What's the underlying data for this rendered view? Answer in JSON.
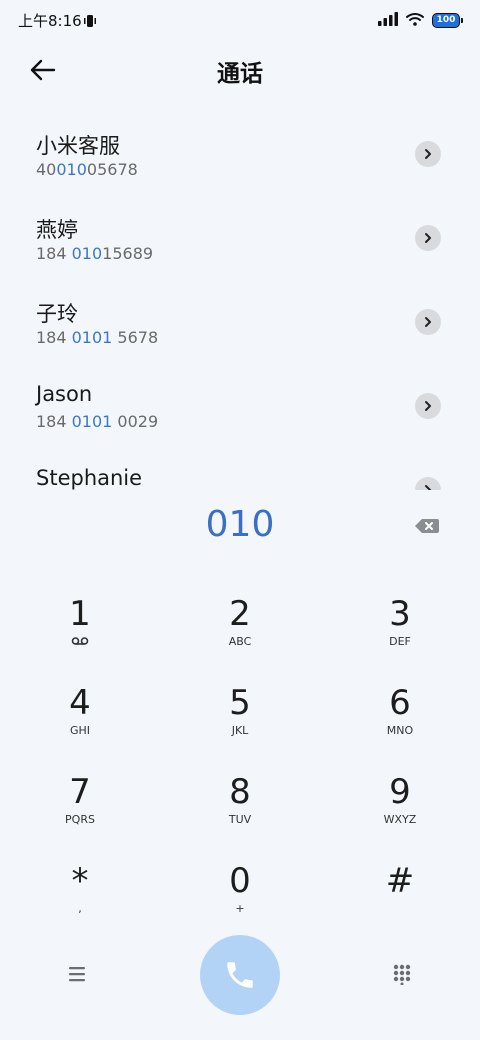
{
  "status_bar": {
    "time": "上午8:16",
    "battery": "100"
  },
  "header": {
    "title": "通话"
  },
  "results": [
    {
      "name": "小米客服",
      "number_pre": "40",
      "number_match": "010",
      "number_post": "05678"
    },
    {
      "name": "燕婷",
      "number_pre": "184 ",
      "number_match": "010",
      "number_post": "15689"
    },
    {
      "name": "子玲",
      "number_pre": "184 ",
      "number_match": "0101",
      "number_post": " 5678"
    },
    {
      "name": "Jason",
      "number_pre": "184 ",
      "number_match": "0101",
      "number_post": " 0029"
    },
    {
      "name": "Stephanie",
      "number_pre": "",
      "number_match": "",
      "number_post": ""
    }
  ],
  "dialer": {
    "number": "010"
  },
  "keypad": [
    {
      "digit": "1",
      "letters": "voicemail-icon"
    },
    {
      "digit": "2",
      "letters": "ABC"
    },
    {
      "digit": "3",
      "letters": "DEF"
    },
    {
      "digit": "4",
      "letters": "GHI"
    },
    {
      "digit": "5",
      "letters": "JKL"
    },
    {
      "digit": "6",
      "letters": "MNO"
    },
    {
      "digit": "7",
      "letters": "PQRS"
    },
    {
      "digit": "8",
      "letters": "TUV"
    },
    {
      "digit": "9",
      "letters": "WXYZ"
    },
    {
      "digit": "*",
      "letters": ","
    },
    {
      "digit": "0",
      "letters": "+"
    },
    {
      "digit": "#",
      "letters": ""
    }
  ],
  "colors": {
    "background": "#f3f7fc",
    "accent": "#3b78c9",
    "call_button": "#b3d3f6"
  }
}
